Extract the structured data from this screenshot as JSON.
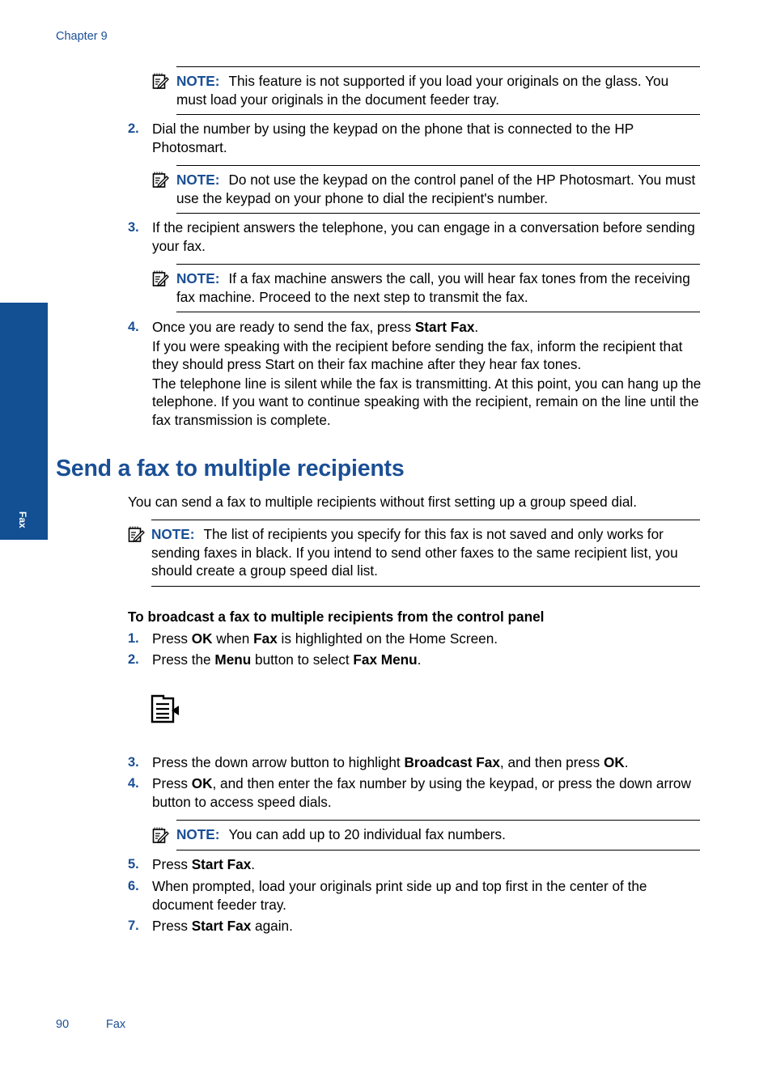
{
  "header": {
    "chapter": "Chapter 9"
  },
  "side_tab": {
    "label": "Fax"
  },
  "colors": {
    "accent": "#1a4f95",
    "side_tab": "#124f93"
  },
  "note_label": "NOTE:",
  "first_section": {
    "note_1": "This feature is not supported if you load your originals on the glass. You must load your originals in the document feeder tray.",
    "steps": [
      {
        "num": "2.",
        "text": "Dial the number by using the keypad on the phone that is connected to the HP Photosmart.",
        "note": "Do not use the keypad on the control panel of the HP Photosmart. You must use the keypad on your phone to dial the recipient's number."
      },
      {
        "num": "3.",
        "text": "If the recipient answers the telephone, you can engage in a conversation before sending your fax.",
        "note": "If a fax machine answers the call, you will hear fax tones from the receiving fax machine. Proceed to the next step to transmit the fax."
      },
      {
        "num": "4.",
        "text_pre": "Once you are ready to send the fax, press ",
        "text_bold": "Start Fax",
        "text_post": ".",
        "para_2": "If you were speaking with the recipient before sending the fax, inform the recipient that they should press Start on their fax machine after they hear fax tones.",
        "para_3": "The telephone line is silent while the fax is transmitting. At this point, you can hang up the telephone. If you want to continue speaking with the recipient, remain on the line until the fax transmission is complete."
      }
    ]
  },
  "section": {
    "title": "Send a fax to multiple recipients",
    "intro": "You can send a fax to multiple recipients without first setting up a group speed dial.",
    "note": "The list of recipients you specify for this fax is not saved and only works for sending faxes in black. If you intend to send other faxes to the same recipient list, you should create a group speed dial list.",
    "procedure_title": "To broadcast a fax to multiple recipients from the control panel",
    "steps": [
      {
        "num": "1.",
        "parts": [
          "Press ",
          "OK",
          " when ",
          "Fax",
          " is highlighted on the Home Screen."
        ]
      },
      {
        "num": "2.",
        "parts": [
          "Press the ",
          "Menu",
          " button to select ",
          "Fax Menu",
          "."
        ]
      },
      {
        "num": "3.",
        "parts": [
          "Press the down arrow button to highlight ",
          "Broadcast Fax",
          ", and then press ",
          "OK",
          "."
        ]
      },
      {
        "num": "4.",
        "parts": [
          "Press ",
          "OK",
          ", and then enter the fax number by using the keypad, or press the down arrow button to access speed dials."
        ]
      },
      {
        "num": "5.",
        "parts": [
          "Press ",
          "Start Fax",
          "."
        ]
      },
      {
        "num": "6.",
        "parts": [
          "When prompted, load your originals print side up and top first in the center of the document feeder tray."
        ]
      },
      {
        "num": "7.",
        "parts": [
          "Press ",
          "Start Fax",
          " again."
        ]
      }
    ],
    "step4_note": "You can add up to 20 individual fax numbers.",
    "menu_icon": "menu-button-icon"
  },
  "footer": {
    "page_number": "90",
    "section": "Fax"
  }
}
